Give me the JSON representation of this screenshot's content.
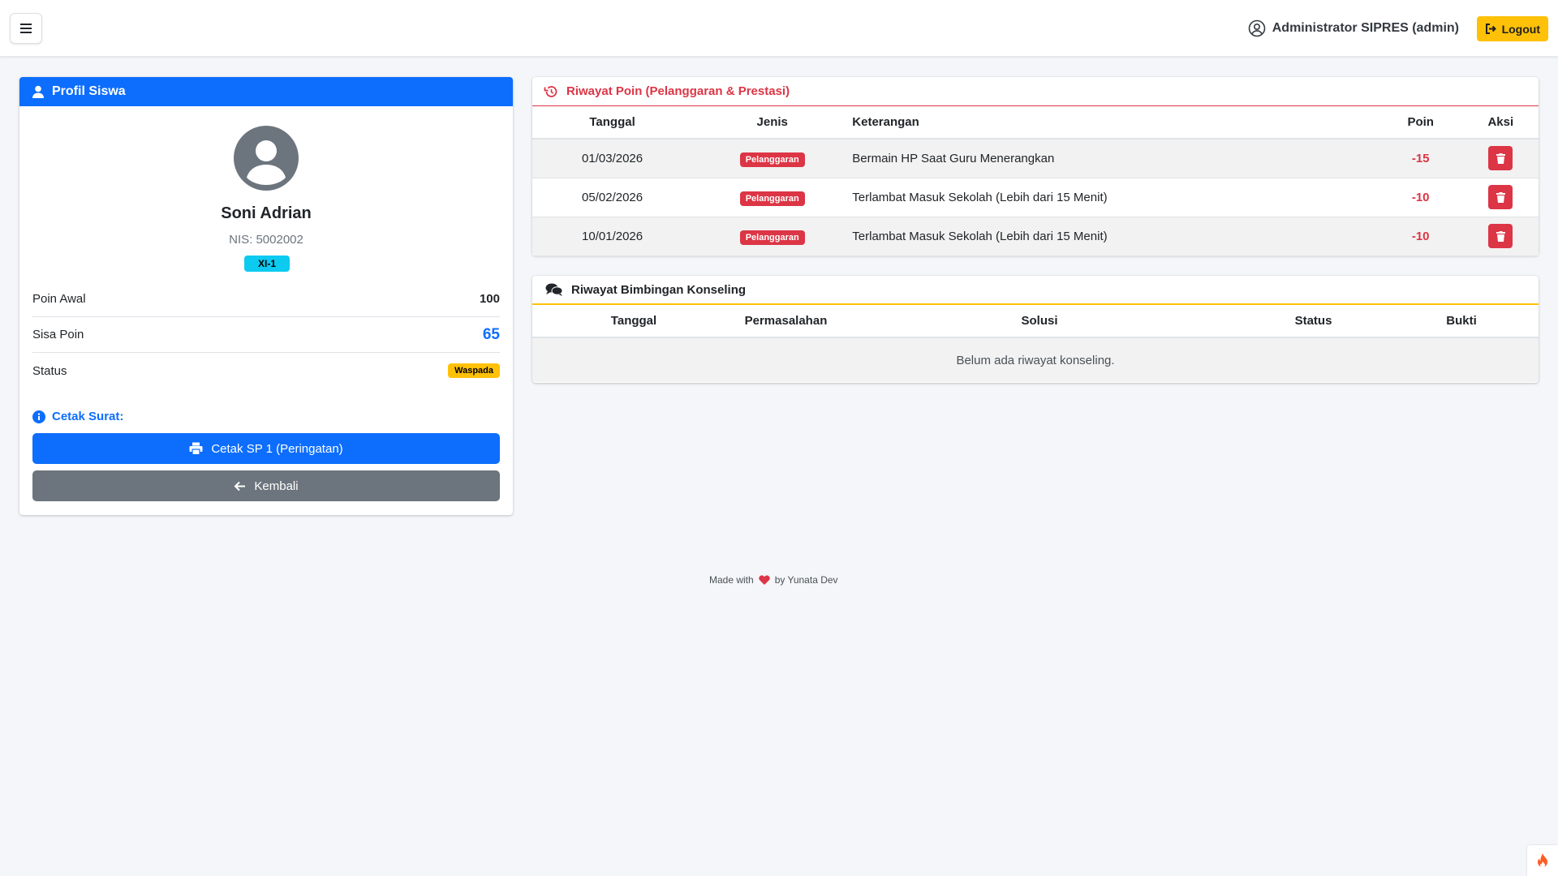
{
  "navbar": {
    "user_label": "Administrator SIPRES (admin)",
    "logout_label": "Logout"
  },
  "profile": {
    "header": "Profil Siswa",
    "name": "Soni Adrian",
    "nis": "NIS: 5002002",
    "class": "XI-1",
    "poin_awal_label": "Poin Awal",
    "poin_awal_value": "100",
    "sisa_poin_label": "Sisa Poin",
    "sisa_poin_value": "65",
    "status_label": "Status",
    "status_value": "Waspada",
    "cetak_label": "Cetak Surat:",
    "cetak_button": "Cetak SP 1 (Peringatan)",
    "back_button": "Kembali"
  },
  "history": {
    "title": "Riwayat Poin (Pelanggaran & Prestasi)",
    "columns": [
      "Tanggal",
      "Jenis",
      "Keterangan",
      "Poin",
      "Aksi"
    ],
    "rows": [
      {
        "tanggal": "01/03/2026",
        "jenis": "Pelanggaran",
        "keterangan": "Bermain HP Saat Guru Menerangkan",
        "poin": "-15"
      },
      {
        "tanggal": "05/02/2026",
        "jenis": "Pelanggaran",
        "keterangan": "Terlambat Masuk Sekolah (Lebih dari 15 Menit)",
        "poin": "-10"
      },
      {
        "tanggal": "10/01/2026",
        "jenis": "Pelanggaran",
        "keterangan": "Terlambat Masuk Sekolah (Lebih dari 15 Menit)",
        "poin": "-10"
      }
    ]
  },
  "konseling": {
    "title": "Riwayat Bimbingan Konseling",
    "columns": [
      "Tanggal",
      "Permasalahan",
      "Solusi",
      "Status",
      "Bukti"
    ],
    "empty_message": "Belum ada riwayat konseling."
  },
  "footer": {
    "made_with": "Made with",
    "by": "by Yunata Dev"
  },
  "colors": {
    "primary": "#0d6efd",
    "danger": "#dc3545",
    "warning": "#ffc107",
    "info": "#0dcaf0",
    "secondary": "#6c757d"
  }
}
